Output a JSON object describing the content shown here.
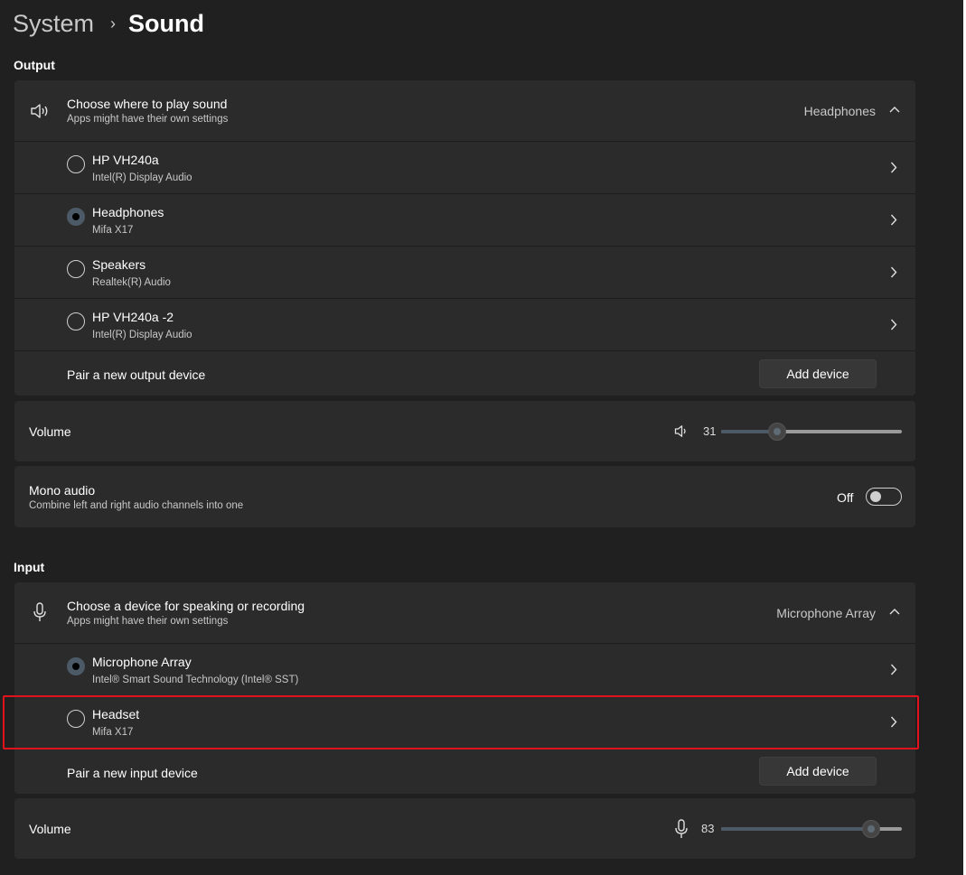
{
  "breadcrumb": {
    "parent": "System",
    "separator": "›",
    "current": "Sound"
  },
  "output": {
    "section_label": "Output",
    "chooser": {
      "title": "Choose where to play sound",
      "subtitle": "Apps might have their own settings",
      "selected_value": "Headphones",
      "icon": "speaker-icon",
      "expanded": true
    },
    "devices": [
      {
        "name": "HP VH240a",
        "driver": "Intel(R) Display Audio",
        "selected": false
      },
      {
        "name": "Headphones",
        "driver": "Mifa X17",
        "selected": true
      },
      {
        "name": "Speakers",
        "driver": "Realtek(R) Audio",
        "selected": false
      },
      {
        "name": "HP VH240a -2",
        "driver": "Intel(R) Display Audio",
        "selected": false
      }
    ],
    "pair_label": "Pair a new output device",
    "add_button": "Add device",
    "volume": {
      "label": "Volume",
      "value": "31",
      "level": 0.31
    },
    "mono": {
      "title": "Mono audio",
      "subtitle": "Combine left and right audio channels into one",
      "state_label": "Off",
      "on": false
    }
  },
  "input": {
    "section_label": "Input",
    "chooser": {
      "title": "Choose a device for speaking or recording",
      "subtitle": "Apps might have their own settings",
      "selected_value": "Microphone Array",
      "icon": "microphone-icon",
      "expanded": true
    },
    "devices": [
      {
        "name": "Microphone Array",
        "driver": "Intel® Smart Sound Technology (Intel® SST)",
        "selected": true
      },
      {
        "name": "Headset",
        "driver": "Mifa X17",
        "selected": false
      }
    ],
    "pair_label": "Pair a new input device",
    "add_button": "Add device",
    "volume": {
      "label": "Volume",
      "value": "83",
      "level": 0.83
    }
  },
  "colors": {
    "background": "#202020",
    "card": "#2b2b2b",
    "accent": "#4b5a66",
    "highlight_border": "#e0121c"
  }
}
